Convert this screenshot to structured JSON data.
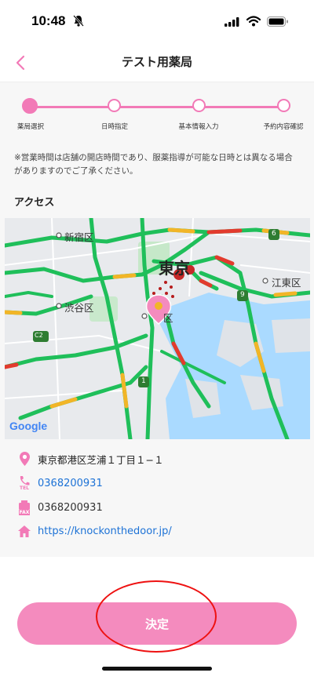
{
  "status_bar": {
    "time": "10:48"
  },
  "nav": {
    "title": "テスト用薬局"
  },
  "stepper": {
    "steps": [
      {
        "label": "薬局選択",
        "active": true
      },
      {
        "label": "日時指定",
        "active": false
      },
      {
        "label": "基本情報入力",
        "active": false
      },
      {
        "label": "予約内容確認",
        "active": false
      }
    ]
  },
  "notice": "※営業時間は店舗の開店時間であり、服薬指導が可能な日時とは異なる場合がありますのでご了承ください。",
  "access": {
    "heading": "アクセス",
    "map": {
      "labels": {
        "shinjuku": "新宿区",
        "shibuya": "渋谷区",
        "tokyo": "東京",
        "koto": "江東区",
        "ku": "区",
        "google": "Google"
      },
      "road_signs": {
        "c2": "C2",
        "one": "1",
        "nine": "9",
        "six": "6"
      }
    },
    "address": "東京都港区芝浦１丁目１−１",
    "tel": "0368200931",
    "tel_badge": "TEL",
    "fax": "0368200931",
    "fax_badge": "FAX",
    "url": "https://knockonthedoor.jp/"
  },
  "footer": {
    "confirm_label": "決定"
  },
  "colors": {
    "accent": "#f27ab7",
    "button": "#f48bbe",
    "link": "#1d72d6",
    "annotation": "#ee1111"
  }
}
